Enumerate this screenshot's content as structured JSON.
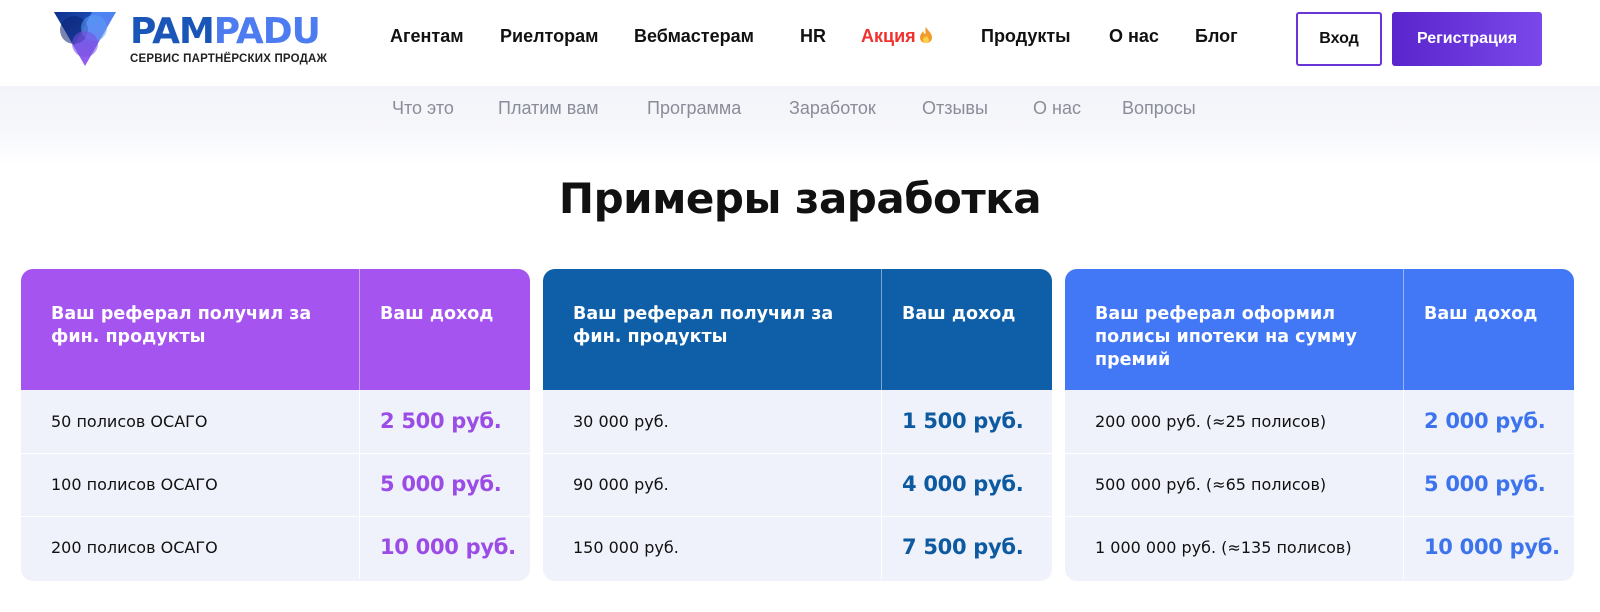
{
  "brand": {
    "logo_main_a": "PAM",
    "logo_main_b": "PADU",
    "tagline": "СЕРВИС ПАРТНЁРСКИХ ПРОДАЖ"
  },
  "nav": {
    "items": [
      {
        "label": "Агентам"
      },
      {
        "label": "Риелторам"
      },
      {
        "label": "Вебмастерам"
      },
      {
        "label": "HR"
      },
      {
        "label": "Акция"
      },
      {
        "label": "Продукты"
      },
      {
        "label": "О нас"
      },
      {
        "label": "Блог"
      }
    ],
    "login_label": "Вход",
    "register_label": "Регистрация"
  },
  "subnav": {
    "items": [
      {
        "label": "Что это"
      },
      {
        "label": "Платим вам"
      },
      {
        "label": "Программа"
      },
      {
        "label": "Заработок"
      },
      {
        "label": "Отзывы"
      },
      {
        "label": "О нас"
      },
      {
        "label": "Вопросы"
      }
    ]
  },
  "section": {
    "title": "Примеры заработка"
  },
  "cards": [
    {
      "header_left": "Ваш реферал получил за фин. продукты",
      "header_right": "Ваш доход",
      "header_color": "#a554f0",
      "value_color": "#9b4ce6",
      "rows": [
        {
          "left": "50 полисов ОСАГО",
          "right": "2 500 руб."
        },
        {
          "left": "100 полисов ОСАГО",
          "right": "5 000 руб."
        },
        {
          "left": "200 полисов ОСАГО",
          "right": "10 000 руб."
        }
      ]
    },
    {
      "header_left": "Ваш реферал получил за фин. продукты",
      "header_right": "Ваш доход",
      "header_color": "#0e5fa8",
      "value_color": "#0e5aa0",
      "rows": [
        {
          "left": "30 000 руб.",
          "right": "1 500 руб."
        },
        {
          "left": "90 000 руб.",
          "right": "4 000 руб."
        },
        {
          "left": "150 000 руб.",
          "right": "7 500 руб."
        }
      ]
    },
    {
      "header_left": "Ваш реферал оформил полисы ипотеки на сумму премий",
      "header_right": "Ваш доход",
      "header_color": "#4278f5",
      "value_color": "#3d74ee",
      "rows": [
        {
          "left": "200 000 руб. (≈25 полисов)",
          "right": "2 000 руб."
        },
        {
          "left": "500 000 руб. (≈65 полисов)",
          "right": "5 000 руб."
        },
        {
          "left": "1 000 000 руб. (≈135 полисов)",
          "right": "10 000 руб."
        }
      ]
    }
  ],
  "icons": {
    "logo": "triangle-logo-icon",
    "promo": "fire-icon"
  }
}
